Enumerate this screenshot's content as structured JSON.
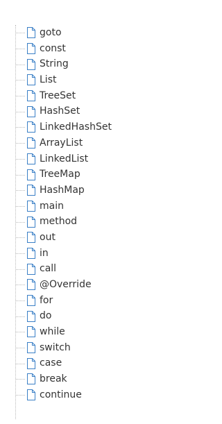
{
  "tree": {
    "items": [
      {
        "label": "goto",
        "icon": "file-icon"
      },
      {
        "label": "const",
        "icon": "file-icon"
      },
      {
        "label": "String",
        "icon": "file-icon"
      },
      {
        "label": "List",
        "icon": "file-icon"
      },
      {
        "label": "TreeSet",
        "icon": "file-icon"
      },
      {
        "label": "HashSet",
        "icon": "file-icon"
      },
      {
        "label": "LinkedHashSet",
        "icon": "file-icon"
      },
      {
        "label": "ArrayList",
        "icon": "file-icon"
      },
      {
        "label": "LinkedList",
        "icon": "file-icon"
      },
      {
        "label": "TreeMap",
        "icon": "file-icon"
      },
      {
        "label": "HashMap",
        "icon": "file-icon"
      },
      {
        "label": "main",
        "icon": "file-icon"
      },
      {
        "label": "method",
        "icon": "file-icon"
      },
      {
        "label": "out",
        "icon": "file-icon"
      },
      {
        "label": "in",
        "icon": "file-icon"
      },
      {
        "label": "call",
        "icon": "file-icon"
      },
      {
        "label": "@Override",
        "icon": "file-icon"
      },
      {
        "label": "for",
        "icon": "file-icon"
      },
      {
        "label": "do",
        "icon": "file-icon"
      },
      {
        "label": "while",
        "icon": "file-icon"
      },
      {
        "label": "switch",
        "icon": "file-icon"
      },
      {
        "label": "case",
        "icon": "file-icon"
      },
      {
        "label": "break",
        "icon": "file-icon"
      },
      {
        "label": "continue",
        "icon": "file-icon"
      }
    ]
  },
  "colors": {
    "icon_border": "#3a7fc6",
    "icon_fill": "#ffffff",
    "text": "#333333",
    "connector": "#b9b9b9"
  }
}
